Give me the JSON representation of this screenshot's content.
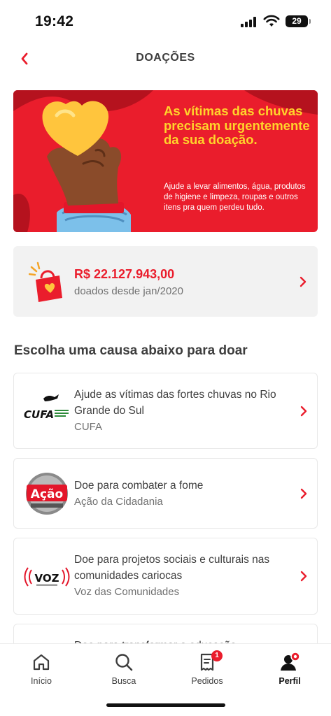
{
  "status_bar": {
    "time": "19:42",
    "battery": "29"
  },
  "header": {
    "title": "DOAÇÕES",
    "back_icon": "chevron-left-icon"
  },
  "banner": {
    "heading": "As vítimas das chuvas precisam urgentemente da sua doação.",
    "body": "Ajude a levar alimentos, água, produtos de higiene e limpeza, roupas e outros itens pra quem perdeu tudo.",
    "colors": {
      "background": "#ea1d2c",
      "heading": "#ffd42b"
    }
  },
  "stats": {
    "amount": "R$ 22.127.943,00",
    "since": "doados desde jan/2020",
    "icon": "heart-bag-icon"
  },
  "section_title": "Escolha uma causa abaixo para doar",
  "causes": [
    {
      "title": "Ajude as vítimas das fortes chuvas no Rio Grande do Sul",
      "org": "CUFA",
      "logo_text": "CUFA"
    },
    {
      "title": "Doe para combater a fome",
      "org": "Ação da Cidadania",
      "logo_text": "Ação"
    },
    {
      "title": "Doe para projetos sociais e culturais nas comunidades cariocas",
      "org": "Voz das Comunidades",
      "logo_text": "VOZ"
    },
    {
      "title": "Doe para transformar a educação"
    }
  ],
  "bottom_nav": {
    "items": [
      {
        "label": "Início",
        "icon": "home-icon"
      },
      {
        "label": "Busca",
        "icon": "search-icon"
      },
      {
        "label": "Pedidos",
        "icon": "receipt-icon",
        "badge": "1"
      },
      {
        "label": "Perfil",
        "icon": "profile-icon"
      }
    ],
    "active": "Perfil"
  },
  "colors": {
    "accent": "#ea1d2c",
    "text": "#3e3e3e",
    "muted": "#717171"
  }
}
